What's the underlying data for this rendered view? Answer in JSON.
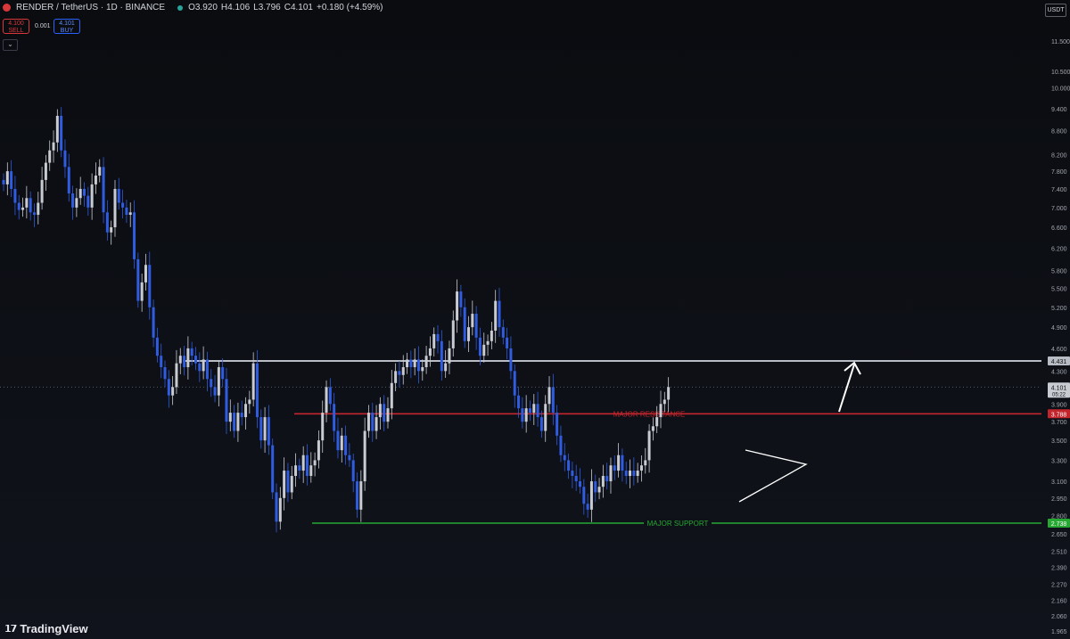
{
  "header": {
    "symbol": "RENDER / TetherUS · 1D · BINANCE",
    "open": "O3.920",
    "high": "H4.106",
    "low": "L3.796",
    "close": "C4.101",
    "change": "+0.180 (+4.59%)"
  },
  "trade": {
    "sell_price": "4.100",
    "sell_label": "SELL",
    "spread": "0.001",
    "buy_price": "4.101",
    "buy_label": "BUY"
  },
  "currency": "USDT",
  "branding": "TradingView",
  "colors": {
    "bull": "#c8cbd2",
    "bear": "#2f5ce0",
    "resistance": "#c2262c",
    "support": "#26a832",
    "range": "#b8bcc4",
    "annotation": "#ffffff"
  },
  "chart_data": {
    "type": "candlestick",
    "scale": "log",
    "ylim": [
      1.965,
      11.5
    ],
    "y_ticks": [
      "11.500",
      "10.500",
      "10.000",
      "9.400",
      "8.800",
      "8.200",
      "7.800",
      "7.400",
      "7.000",
      "6.600",
      "6.200",
      "5.800",
      "5.500",
      "5.200",
      "4.900",
      "4.600",
      "4.300",
      "3.900",
      "3.700",
      "3.500",
      "3.300",
      "3.100",
      "2.950",
      "2.800",
      "2.650",
      "2.510",
      "2.390",
      "2.270",
      "2.160",
      "2.060",
      "1.965"
    ],
    "price_badges": [
      {
        "label": "4.431",
        "value": 4.431,
        "color": "#b8bcc4"
      },
      {
        "label": "4.101",
        "sublabel": "05:22",
        "value": 4.101,
        "color": "#c8cbd2"
      },
      {
        "label": "3.788",
        "value": 3.788,
        "color": "#c2262c"
      },
      {
        "label": "2.738",
        "value": 2.738,
        "color": "#26a832"
      }
    ],
    "levels": [
      {
        "name": "range-line",
        "value": 4.431,
        "label": ""
      },
      {
        "name": "major-resistance",
        "value": 3.788,
        "label": "MAJOR RESISTANCE"
      },
      {
        "name": "major-support",
        "value": 2.738,
        "label": "MAJOR SUPPORT"
      }
    ],
    "current_price": 4.101,
    "closes": [
      7.5,
      7.8,
      7.4,
      7.1,
      6.95,
      7.0,
      7.2,
      6.9,
      6.85,
      7.1,
      7.6,
      8.0,
      8.3,
      8.5,
      9.2,
      8.3,
      7.9,
      7.3,
      7.0,
      7.2,
      7.4,
      7.25,
      7.0,
      7.5,
      7.7,
      7.9,
      6.9,
      6.5,
      6.6,
      7.4,
      7.1,
      7.0,
      6.85,
      6.9,
      6.0,
      5.3,
      5.6,
      5.9,
      5.2,
      4.75,
      4.5,
      4.35,
      4.2,
      4.0,
      4.1,
      4.4,
      4.5,
      4.35,
      4.6,
      4.5,
      4.4,
      4.3,
      4.45,
      4.2,
      4.1,
      4.0,
      4.35,
      4.2,
      3.7,
      3.8,
      3.6,
      3.8,
      3.75,
      3.9,
      3.95,
      4.4,
      3.75,
      3.5,
      3.75,
      3.45,
      3.0,
      2.75,
      2.95,
      3.2,
      3.0,
      3.15,
      3.25,
      3.2,
      3.35,
      3.15,
      3.25,
      3.3,
      3.5,
      3.8,
      4.1,
      3.9,
      3.6,
      3.4,
      3.55,
      3.35,
      3.3,
      3.1,
      2.85,
      3.1,
      3.6,
      3.8,
      3.6,
      3.75,
      3.9,
      3.7,
      3.85,
      4.15,
      4.3,
      4.25,
      4.35,
      4.45,
      4.35,
      4.45,
      4.3,
      4.35,
      4.5,
      4.6,
      4.8,
      4.7,
      4.3,
      4.4,
      4.6,
      5.0,
      5.45,
      5.2,
      4.7,
      4.9,
      5.1,
      4.75,
      4.5,
      4.65,
      4.7,
      4.85,
      5.3,
      4.9,
      4.75,
      4.6,
      4.3,
      4.0,
      3.85,
      3.7,
      3.85,
      3.8,
      3.9,
      3.75,
      3.6,
      3.9,
      4.1,
      3.8,
      3.55,
      3.35,
      3.3,
      3.2,
      3.15,
      3.1,
      3.05,
      2.9,
      2.85,
      3.1,
      3.0,
      3.05,
      3.15,
      3.1,
      3.25,
      3.2,
      3.35,
      3.2,
      3.15,
      3.2,
      3.15,
      3.2,
      3.25,
      3.3,
      3.6,
      3.65,
      3.75,
      3.9,
      3.95,
      4.1
    ]
  }
}
